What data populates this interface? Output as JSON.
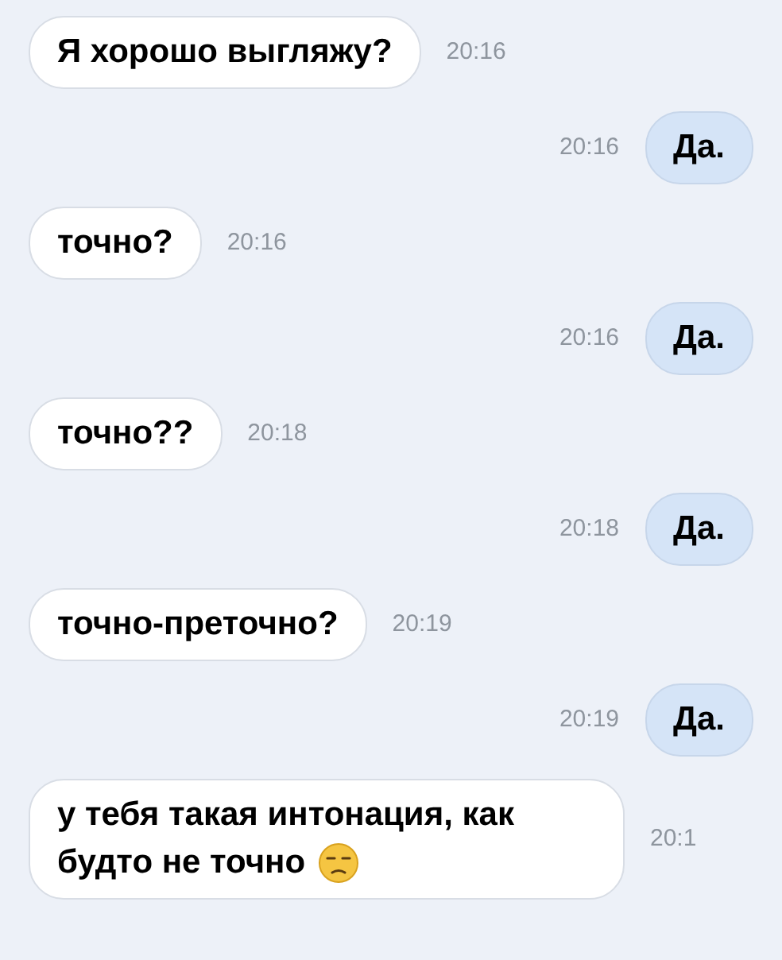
{
  "messages": [
    {
      "kind": "incoming",
      "text": "Я хорошо выгляжу?",
      "time": "20:16"
    },
    {
      "kind": "outgoing",
      "text": "Да.",
      "time": "20:16"
    },
    {
      "kind": "incoming",
      "text": "точно?",
      "time": "20:16"
    },
    {
      "kind": "outgoing",
      "text": "Да.",
      "time": "20:16"
    },
    {
      "kind": "incoming",
      "text": "точно??",
      "time": "20:18"
    },
    {
      "kind": "outgoing",
      "text": "Да.",
      "time": "20:18"
    },
    {
      "kind": "incoming",
      "text": "точно-преточно?",
      "time": "20:19"
    },
    {
      "kind": "outgoing",
      "text": "Да.",
      "time": "20:19"
    },
    {
      "kind": "incoming",
      "text": "у тебя такая интонация, как будто не точно",
      "emoji": true,
      "time": "20:1"
    }
  ]
}
